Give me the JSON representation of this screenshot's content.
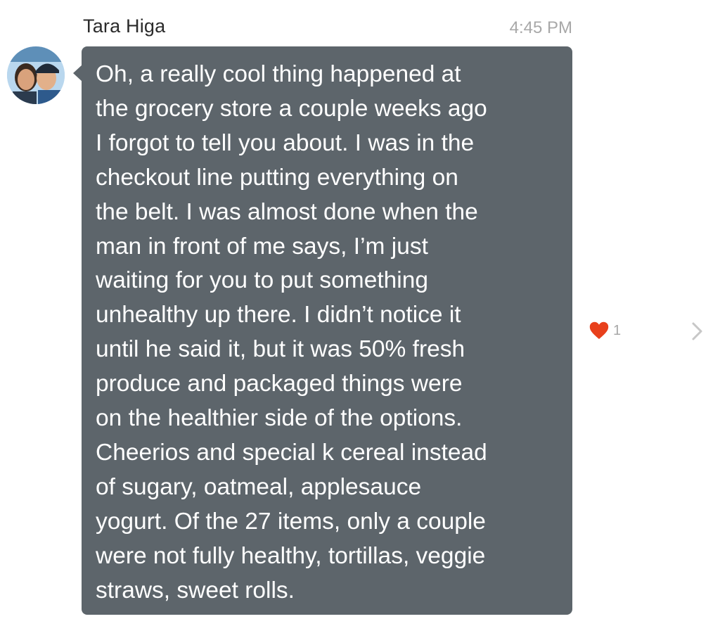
{
  "message": {
    "sender": "Tara Higa",
    "time": "4:45 PM",
    "text": "Oh, a really cool thing happened at\nthe grocery store a couple weeks ago\nI forgot to tell you about. I was in the\ncheckout line putting everything on\nthe belt. I was almost done when the\nman in front of me says, I’m just\nwaiting for you to put something\nunhealthy up there. I didn’t notice it\nuntil he said it, but it was 50% fresh\nproduce and packaged things were\non the healthier side of the options.\nCheerios and special k cereal instead\nof sugary, oatmeal, applesauce\nyogurt. Of the 27 items, only a couple\nwere not fully healthy, tortillas, veggie\nstraws, sweet rolls.",
    "reaction": {
      "icon": "heart-icon",
      "count": "1",
      "color": "#e8401c"
    },
    "bubble_color": "#5d656b"
  }
}
